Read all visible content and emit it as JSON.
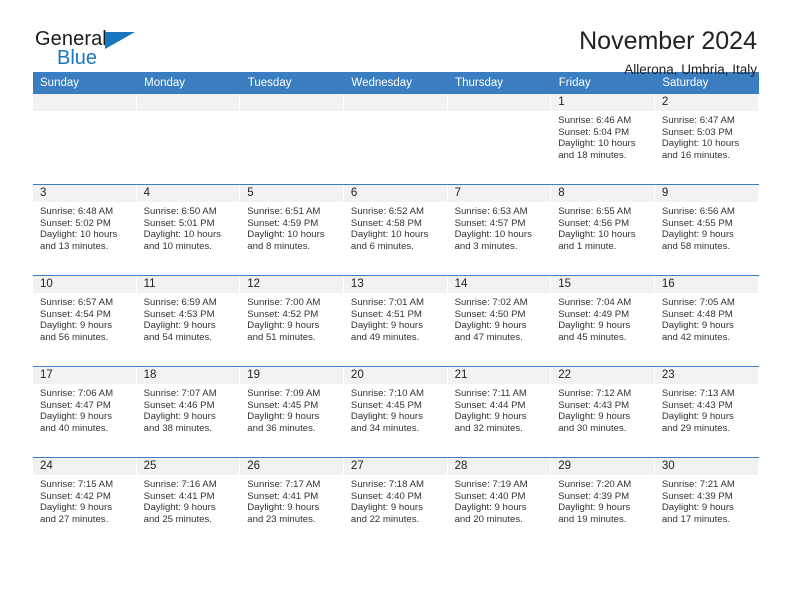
{
  "logo": {
    "word_one": "General",
    "word_two": "Blue",
    "triangle_color": "#1975bc"
  },
  "header": {
    "title": "November 2024",
    "subtitle": "Allerona, Umbria, Italy"
  },
  "colors": {
    "header_bar": "#3a7dc0",
    "daynum_band": "#f2f2f2",
    "text": "#222222"
  },
  "calendar": {
    "weekday_headers": [
      "Sunday",
      "Monday",
      "Tuesday",
      "Wednesday",
      "Thursday",
      "Friday",
      "Saturday"
    ],
    "labels": {
      "sunrise": "Sunrise:",
      "sunset": "Sunset:",
      "daylight": "Daylight:"
    },
    "weeks": [
      [
        {
          "day": ""
        },
        {
          "day": ""
        },
        {
          "day": ""
        },
        {
          "day": ""
        },
        {
          "day": ""
        },
        {
          "day": "1",
          "sunrise": "Sunrise: 6:46 AM",
          "sunset": "Sunset: 5:04 PM",
          "daylight_line1": "Daylight: 10 hours",
          "daylight_line2": "and 18 minutes."
        },
        {
          "day": "2",
          "sunrise": "Sunrise: 6:47 AM",
          "sunset": "Sunset: 5:03 PM",
          "daylight_line1": "Daylight: 10 hours",
          "daylight_line2": "and 16 minutes."
        }
      ],
      [
        {
          "day": "3",
          "sunrise": "Sunrise: 6:48 AM",
          "sunset": "Sunset: 5:02 PM",
          "daylight_line1": "Daylight: 10 hours",
          "daylight_line2": "and 13 minutes."
        },
        {
          "day": "4",
          "sunrise": "Sunrise: 6:50 AM",
          "sunset": "Sunset: 5:01 PM",
          "daylight_line1": "Daylight: 10 hours",
          "daylight_line2": "and 10 minutes."
        },
        {
          "day": "5",
          "sunrise": "Sunrise: 6:51 AM",
          "sunset": "Sunset: 4:59 PM",
          "daylight_line1": "Daylight: 10 hours",
          "daylight_line2": "and 8 minutes."
        },
        {
          "day": "6",
          "sunrise": "Sunrise: 6:52 AM",
          "sunset": "Sunset: 4:58 PM",
          "daylight_line1": "Daylight: 10 hours",
          "daylight_line2": "and 6 minutes."
        },
        {
          "day": "7",
          "sunrise": "Sunrise: 6:53 AM",
          "sunset": "Sunset: 4:57 PM",
          "daylight_line1": "Daylight: 10 hours",
          "daylight_line2": "and 3 minutes."
        },
        {
          "day": "8",
          "sunrise": "Sunrise: 6:55 AM",
          "sunset": "Sunset: 4:56 PM",
          "daylight_line1": "Daylight: 10 hours",
          "daylight_line2": "and 1 minute."
        },
        {
          "day": "9",
          "sunrise": "Sunrise: 6:56 AM",
          "sunset": "Sunset: 4:55 PM",
          "daylight_line1": "Daylight: 9 hours",
          "daylight_line2": "and 58 minutes."
        }
      ],
      [
        {
          "day": "10",
          "sunrise": "Sunrise: 6:57 AM",
          "sunset": "Sunset: 4:54 PM",
          "daylight_line1": "Daylight: 9 hours",
          "daylight_line2": "and 56 minutes."
        },
        {
          "day": "11",
          "sunrise": "Sunrise: 6:59 AM",
          "sunset": "Sunset: 4:53 PM",
          "daylight_line1": "Daylight: 9 hours",
          "daylight_line2": "and 54 minutes."
        },
        {
          "day": "12",
          "sunrise": "Sunrise: 7:00 AM",
          "sunset": "Sunset: 4:52 PM",
          "daylight_line1": "Daylight: 9 hours",
          "daylight_line2": "and 51 minutes."
        },
        {
          "day": "13",
          "sunrise": "Sunrise: 7:01 AM",
          "sunset": "Sunset: 4:51 PM",
          "daylight_line1": "Daylight: 9 hours",
          "daylight_line2": "and 49 minutes."
        },
        {
          "day": "14",
          "sunrise": "Sunrise: 7:02 AM",
          "sunset": "Sunset: 4:50 PM",
          "daylight_line1": "Daylight: 9 hours",
          "daylight_line2": "and 47 minutes."
        },
        {
          "day": "15",
          "sunrise": "Sunrise: 7:04 AM",
          "sunset": "Sunset: 4:49 PM",
          "daylight_line1": "Daylight: 9 hours",
          "daylight_line2": "and 45 minutes."
        },
        {
          "day": "16",
          "sunrise": "Sunrise: 7:05 AM",
          "sunset": "Sunset: 4:48 PM",
          "daylight_line1": "Daylight: 9 hours",
          "daylight_line2": "and 42 minutes."
        }
      ],
      [
        {
          "day": "17",
          "sunrise": "Sunrise: 7:06 AM",
          "sunset": "Sunset: 4:47 PM",
          "daylight_line1": "Daylight: 9 hours",
          "daylight_line2": "and 40 minutes."
        },
        {
          "day": "18",
          "sunrise": "Sunrise: 7:07 AM",
          "sunset": "Sunset: 4:46 PM",
          "daylight_line1": "Daylight: 9 hours",
          "daylight_line2": "and 38 minutes."
        },
        {
          "day": "19",
          "sunrise": "Sunrise: 7:09 AM",
          "sunset": "Sunset: 4:45 PM",
          "daylight_line1": "Daylight: 9 hours",
          "daylight_line2": "and 36 minutes."
        },
        {
          "day": "20",
          "sunrise": "Sunrise: 7:10 AM",
          "sunset": "Sunset: 4:45 PM",
          "daylight_line1": "Daylight: 9 hours",
          "daylight_line2": "and 34 minutes."
        },
        {
          "day": "21",
          "sunrise": "Sunrise: 7:11 AM",
          "sunset": "Sunset: 4:44 PM",
          "daylight_line1": "Daylight: 9 hours",
          "daylight_line2": "and 32 minutes."
        },
        {
          "day": "22",
          "sunrise": "Sunrise: 7:12 AM",
          "sunset": "Sunset: 4:43 PM",
          "daylight_line1": "Daylight: 9 hours",
          "daylight_line2": "and 30 minutes."
        },
        {
          "day": "23",
          "sunrise": "Sunrise: 7:13 AM",
          "sunset": "Sunset: 4:43 PM",
          "daylight_line1": "Daylight: 9 hours",
          "daylight_line2": "and 29 minutes."
        }
      ],
      [
        {
          "day": "24",
          "sunrise": "Sunrise: 7:15 AM",
          "sunset": "Sunset: 4:42 PM",
          "daylight_line1": "Daylight: 9 hours",
          "daylight_line2": "and 27 minutes."
        },
        {
          "day": "25",
          "sunrise": "Sunrise: 7:16 AM",
          "sunset": "Sunset: 4:41 PM",
          "daylight_line1": "Daylight: 9 hours",
          "daylight_line2": "and 25 minutes."
        },
        {
          "day": "26",
          "sunrise": "Sunrise: 7:17 AM",
          "sunset": "Sunset: 4:41 PM",
          "daylight_line1": "Daylight: 9 hours",
          "daylight_line2": "and 23 minutes."
        },
        {
          "day": "27",
          "sunrise": "Sunrise: 7:18 AM",
          "sunset": "Sunset: 4:40 PM",
          "daylight_line1": "Daylight: 9 hours",
          "daylight_line2": "and 22 minutes."
        },
        {
          "day": "28",
          "sunrise": "Sunrise: 7:19 AM",
          "sunset": "Sunset: 4:40 PM",
          "daylight_line1": "Daylight: 9 hours",
          "daylight_line2": "and 20 minutes."
        },
        {
          "day": "29",
          "sunrise": "Sunrise: 7:20 AM",
          "sunset": "Sunset: 4:39 PM",
          "daylight_line1": "Daylight: 9 hours",
          "daylight_line2": "and 19 minutes."
        },
        {
          "day": "30",
          "sunrise": "Sunrise: 7:21 AM",
          "sunset": "Sunset: 4:39 PM",
          "daylight_line1": "Daylight: 9 hours",
          "daylight_line2": "and 17 minutes."
        }
      ]
    ]
  }
}
